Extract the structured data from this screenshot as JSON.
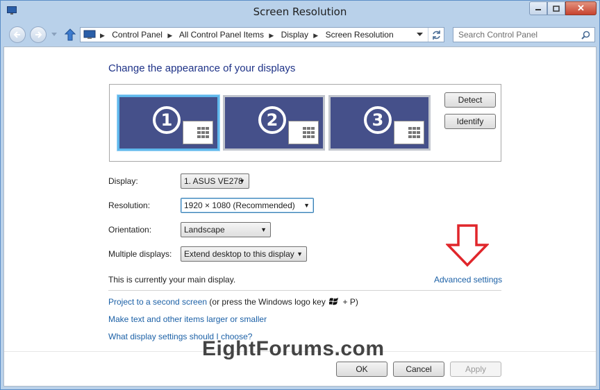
{
  "window": {
    "title": "Screen Resolution",
    "close_glyph": "✕"
  },
  "nav": {
    "breadcrumbs": [
      "Control Panel",
      "All Control Panel Items",
      "Display",
      "Screen Resolution"
    ],
    "search_placeholder": "Search Control Panel"
  },
  "main": {
    "heading": "Change the appearance of your displays",
    "monitors": [
      {
        "number": "1",
        "selected": true
      },
      {
        "number": "2",
        "selected": false
      },
      {
        "number": "3",
        "selected": false
      }
    ],
    "detect_label": "Detect",
    "identify_label": "Identify",
    "fields": {
      "display_label": "Display:",
      "display_value": "1. ASUS VE278",
      "resolution_label": "Resolution:",
      "resolution_value": "1920 × 1080 (Recommended)",
      "orientation_label": "Orientation:",
      "orientation_value": "Landscape",
      "multiple_label": "Multiple displays:",
      "multiple_value": "Extend desktop to this display"
    },
    "main_display_text": "This is currently your main display.",
    "advanced_settings": "Advanced settings",
    "project_link": "Project to a second screen",
    "project_suffix": "(or press the Windows logo key",
    "project_key": "+ P)",
    "text_size_link": "Make text and other items larger or smaller",
    "which_settings_link": "What display settings should I choose?"
  },
  "buttons": {
    "ok": "OK",
    "cancel": "Cancel",
    "apply": "Apply"
  },
  "watermark": {
    "part1": "Eight",
    "part2": "Forums",
    "part3": ".com"
  },
  "colors": {
    "accent_link": "#1b60a6",
    "heading": "#1e3287",
    "arrow": "#e0262b",
    "monitor": "#45508a"
  }
}
